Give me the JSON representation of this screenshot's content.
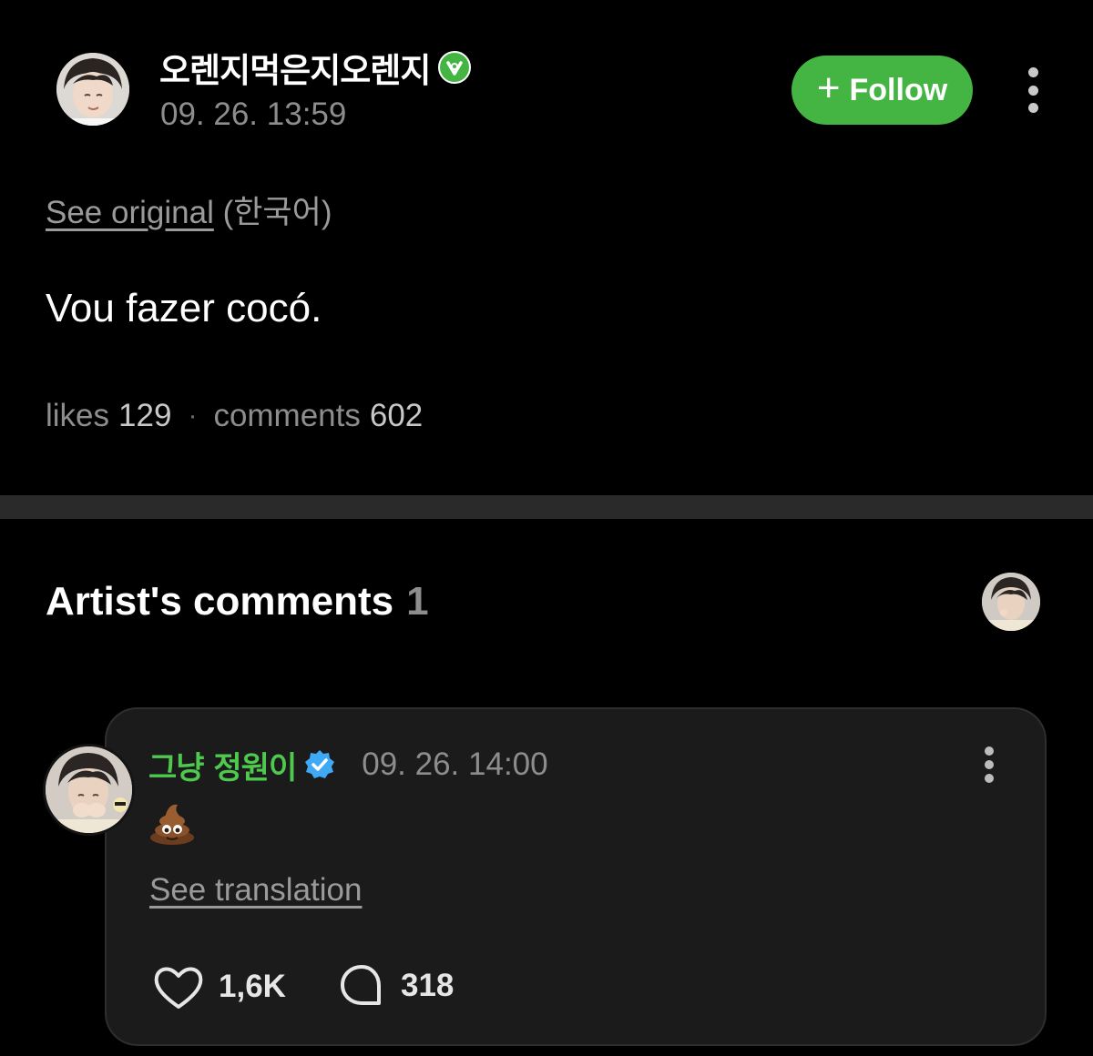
{
  "post": {
    "author_name": "오렌지먹은지오렌지",
    "date": "09. 26. 13:59",
    "follow_label": "Follow",
    "see_original_label": "See original",
    "original_language": "(한국어)",
    "text": "Vou fazer cocó.",
    "likes_label": "likes",
    "likes_count": "129",
    "comments_label": "comments",
    "comments_count": "602",
    "separator": "·"
  },
  "artist_comments": {
    "title": "Artist's comments",
    "count": "1",
    "comment": {
      "author_name": "그냥 정원이",
      "date": "09. 26. 14:00",
      "emoji_icon": "pile-of-poo-icon",
      "see_translation_label": "See translation",
      "likes": "1,6K",
      "replies": "318"
    }
  },
  "colors": {
    "accent_green": "#44b543",
    "name_green": "#4ec94e",
    "verified_blue": "#3fa9f5",
    "background": "#000000",
    "card": "#1b1b1b"
  }
}
